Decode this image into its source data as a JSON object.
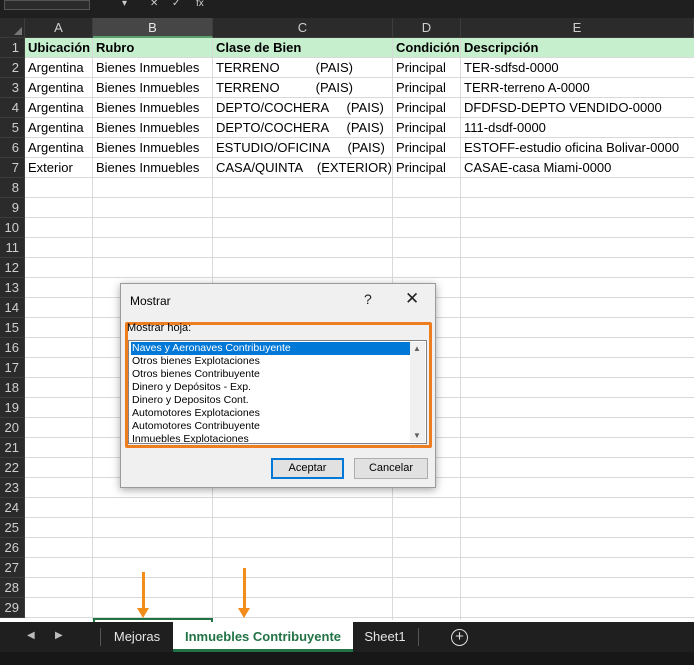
{
  "sheet": {
    "columns": [
      "A",
      "B",
      "C",
      "D",
      "E"
    ],
    "selected_column": "B",
    "row_numbers": [
      "1",
      "2",
      "3",
      "4",
      "5",
      "6",
      "7",
      "8",
      "9",
      "10",
      "11",
      "12",
      "13",
      "14",
      "15",
      "16",
      "17",
      "18",
      "19",
      "20",
      "21",
      "22",
      "23",
      "24",
      "25",
      "26",
      "27",
      "28",
      "29"
    ],
    "header_row": [
      "Ubicación",
      "Rubro",
      "Clase de Bien",
      "Condición",
      "Descripción"
    ],
    "rows": [
      [
        "Argentina",
        "Bienes Inmuebles",
        "TERRENO          (PAIS)",
        "Principal",
        "TER-sdfsd-0000"
      ],
      [
        "Argentina",
        "Bienes Inmuebles",
        "TERRENO          (PAIS)",
        "Principal",
        "TERR-terreno A-0000"
      ],
      [
        "Argentina",
        "Bienes Inmuebles",
        "DEPTO/COCHERA     (PAIS)",
        "Principal",
        "DFDFSD-DEPTO VENDIDO-0000"
      ],
      [
        "Argentina",
        "Bienes Inmuebles",
        "DEPTO/COCHERA     (PAIS)",
        "Principal",
        "111-dsdf-0000"
      ],
      [
        "Argentina",
        "Bienes Inmuebles",
        "ESTUDIO/OFICINA     (PAIS)",
        "Principal",
        "ESTOFF-estudio oficina Bolivar-0000"
      ],
      [
        "Exterior",
        "Bienes Inmuebles",
        "CASA/QUINTA    (EXTERIOR)",
        "Principal",
        "CASAE-casa Miami-0000"
      ]
    ],
    "header_fill": "#c6efce"
  },
  "dialog": {
    "title": "Mostrar",
    "help": "?",
    "close": "✕",
    "list_label": "Mostrar hoja:",
    "items": [
      "Naves y Aeronaves Contribuyente",
      "Otros bienes Explotaciones",
      "Otros bienes Contribuyente",
      "Dinero y Depósitos - Exp.",
      "Dinero y Depositos Cont.",
      "Automotores Explotaciones",
      "Automotores Contribuyente",
      "Inmuebles Explotaciones"
    ],
    "selected_index": 0,
    "ok_label": "Aceptar",
    "cancel_label": "Cancelar",
    "highlight_color": "#ed7d1f"
  },
  "tabs": {
    "items": [
      "Mejoras",
      "Inmuebles Contribuyente",
      "Sheet1"
    ],
    "active": "Inmuebles Contribuyente",
    "add_icon": "plus-circle-icon"
  },
  "annotation_color": "#f28c1a"
}
